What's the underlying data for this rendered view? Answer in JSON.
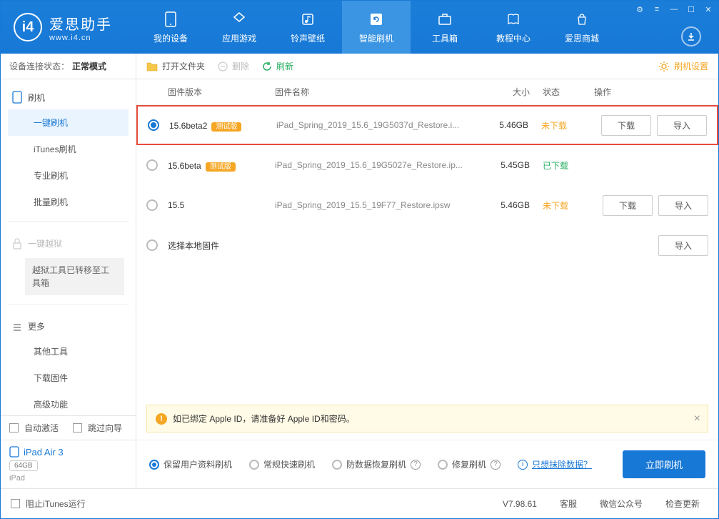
{
  "logo": {
    "title": "爱思助手",
    "sub": "www.i4.cn",
    "badge": "i4"
  },
  "nav": [
    {
      "label": "我的设备"
    },
    {
      "label": "应用游戏"
    },
    {
      "label": "铃声壁纸"
    },
    {
      "label": "智能刷机"
    },
    {
      "label": "工具箱"
    },
    {
      "label": "教程中心"
    },
    {
      "label": "爱思商城"
    }
  ],
  "sidebar": {
    "status_label": "设备连接状态：",
    "status_value": "正常模式",
    "flash": {
      "head": "刷机",
      "items": [
        "一键刷机",
        "iTunes刷机",
        "专业刷机",
        "批量刷机"
      ]
    },
    "jailbreak": {
      "head": "一键越狱",
      "note": "越狱工具已转移至工具箱"
    },
    "more": {
      "head": "更多",
      "items": [
        "其他工具",
        "下载固件",
        "高级功能"
      ]
    },
    "auto_activate": "自动激活",
    "skip_guide": "跳过向导",
    "device_name": "iPad Air 3",
    "device_storage": "64GB",
    "device_type": "iPad"
  },
  "toolbar": {
    "open_folder": "打开文件夹",
    "delete": "删除",
    "refresh": "刷新",
    "settings": "刷机设置"
  },
  "table": {
    "headers": {
      "version": "固件版本",
      "name": "固件名称",
      "size": "大小",
      "status": "状态",
      "action": "操作"
    },
    "rows": [
      {
        "version": "15.6beta2",
        "beta": "测试版",
        "name": "iPad_Spring_2019_15.6_19G5037d_Restore.i...",
        "size": "5.46GB",
        "status": "未下载",
        "status_class": "orange",
        "selected": true,
        "highlighted": true,
        "download": "下载",
        "import": "导入"
      },
      {
        "version": "15.6beta",
        "beta": "测试版",
        "name": "iPad_Spring_2019_15.6_19G5027e_Restore.ip...",
        "size": "5.45GB",
        "status": "已下载",
        "status_class": "green",
        "selected": false
      },
      {
        "version": "15.5",
        "name": "iPad_Spring_2019_15.5_19F77_Restore.ipsw",
        "size": "5.46GB",
        "status": "未下载",
        "status_class": "orange",
        "selected": false,
        "download": "下载",
        "import": "导入"
      },
      {
        "version": "选择本地固件",
        "local": true,
        "import": "导入"
      }
    ]
  },
  "alert": "如已绑定 Apple ID，请准备好 Apple ID和密码。",
  "options": {
    "keep_data": "保留用户资料刷机",
    "normal": "常规快速刷机",
    "anti_recovery": "防数据恢复刷机",
    "repair": "修复刷机",
    "erase_link": "只想抹除数据？",
    "flash_now": "立即刷机"
  },
  "footer": {
    "block_itunes": "阻止iTunes运行",
    "version": "V7.98.61",
    "support": "客服",
    "wechat": "微信公众号",
    "check_update": "检查更新"
  }
}
